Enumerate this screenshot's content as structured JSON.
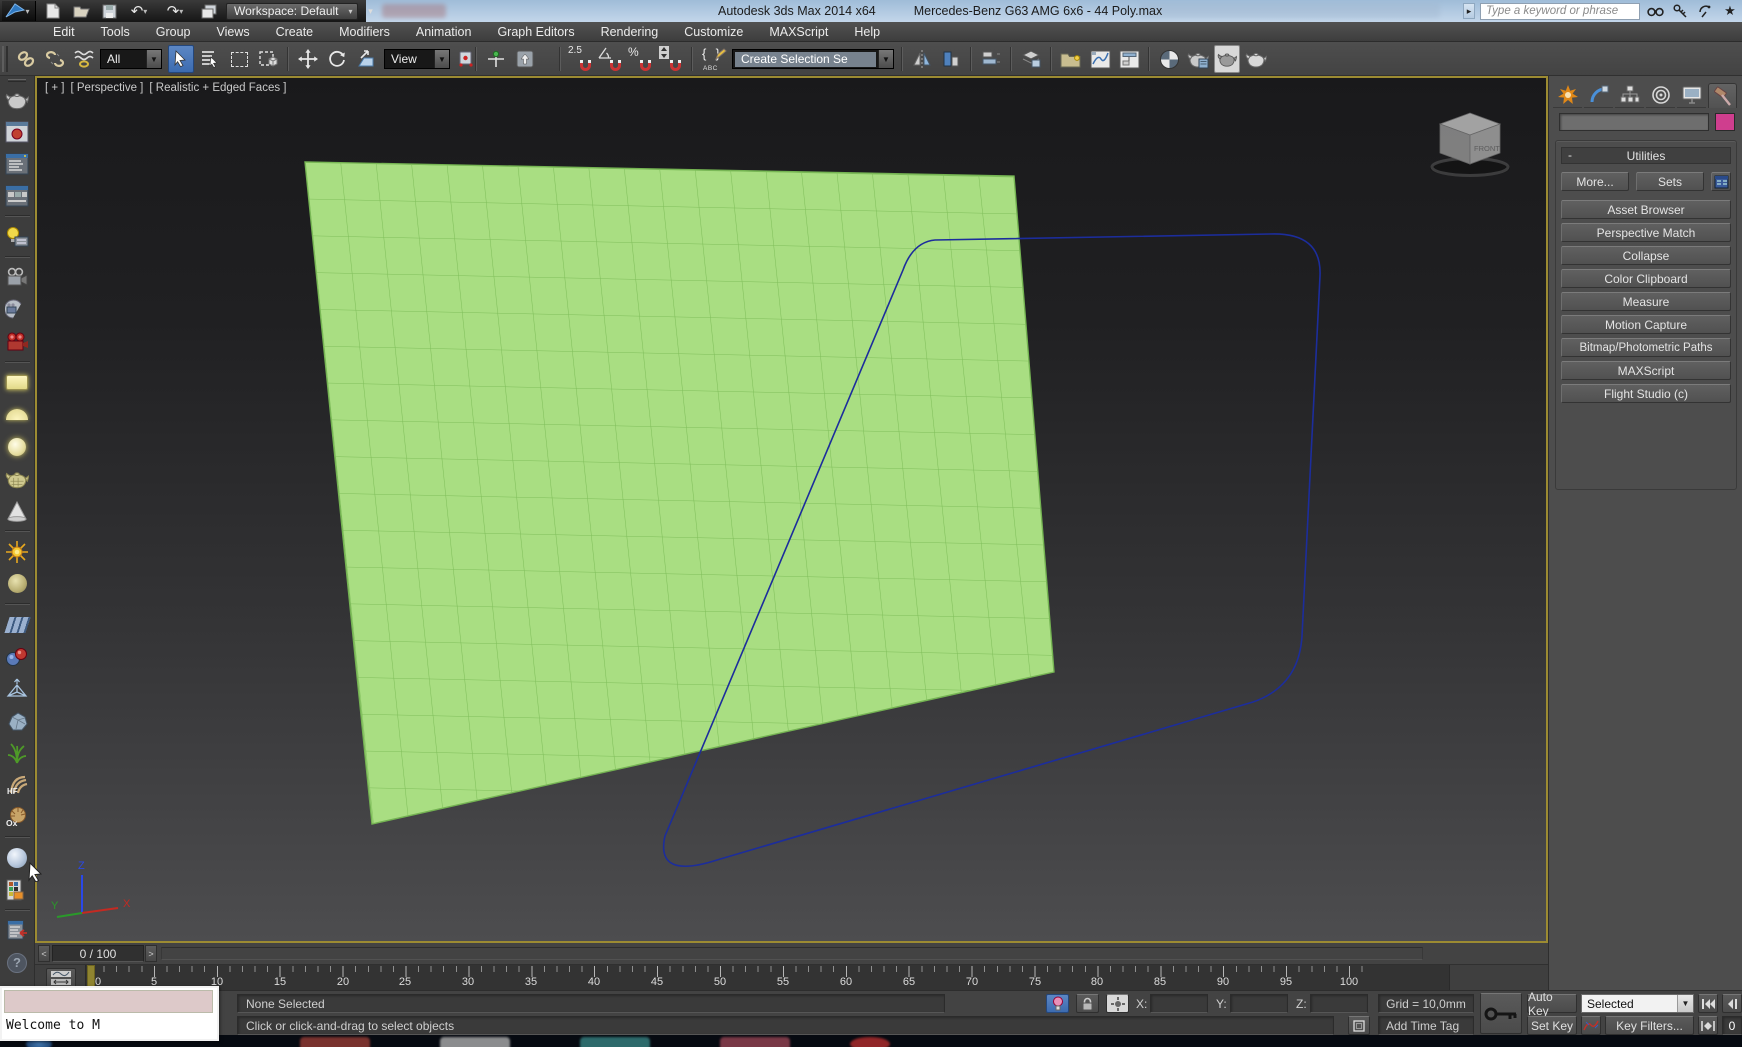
{
  "window": {
    "app_title": "Autodesk 3ds Max  2014 x64",
    "document_title": "Mercedes-Benz G63 AMG 6x6 - 44 Poly.max",
    "workspace_label": "Workspace: Default",
    "search_placeholder": "Type a keyword or phrase"
  },
  "menubar": {
    "items": [
      "Edit",
      "Tools",
      "Group",
      "Views",
      "Create",
      "Modifiers",
      "Animation",
      "Graph Editors",
      "Rendering",
      "Customize",
      "MAXScript",
      "Help"
    ]
  },
  "toolbar": {
    "selection_filter_value": "All",
    "reference_coordsys_value": "View",
    "named_sets_value": "Create Selection Se",
    "snap_25_label": "2.5",
    "snap_percent_label": "%",
    "abc_label": "ABC",
    "icons": [
      "select-and-link",
      "unlink-selection",
      "bind-to-space-warp",
      "selection-filter",
      "select-object",
      "select-by-name",
      "rectangular-selection-region",
      "window-crossing",
      "select-and-move",
      "select-and-rotate",
      "select-and-scale",
      "reference-coordinate-system",
      "use-pivot-point-center",
      "select-and-manipulate",
      "keyboard-shortcut-override",
      "snaps-toggle-2.5",
      "angle-snap",
      "percent-snap",
      "spinner-snap",
      "edit-named-selection-sets",
      "named-selection-sets",
      "mirror",
      "align",
      "layer-manager",
      "graphite-modeling-tools",
      "scene-explorer",
      "curve-editor",
      "schematic-view",
      "material-editor",
      "render-setup",
      "rendered-frame-window",
      "render-production"
    ]
  },
  "viewport": {
    "label_plus": "[ + ]",
    "label_view": "[ Perspective ]",
    "label_shading": "[ Realistic + Edged Faces ]",
    "viewcube_front_label": "FRONT",
    "axis": {
      "x": "X",
      "y": "Y",
      "z": "Z"
    },
    "border_color": "#9c8b32",
    "plane_fill": "#a9de82",
    "plane_grid_color": "#7fbe5a",
    "spline_color": "#1c2d9c"
  },
  "command_panel": {
    "tabs": [
      "create",
      "modify",
      "hierarchy",
      "motion",
      "display",
      "utilities"
    ],
    "active_tab": "utilities",
    "swatch_color": "#cf3e8e",
    "utilities": {
      "header": "Utilities",
      "collapse_glyph": "-",
      "more_label": "More...",
      "sets_label": "Sets",
      "buttons": [
        "Asset Browser",
        "Perspective Match",
        "Collapse",
        "Color Clipboard",
        "Measure",
        "Motion Capture",
        "Bitmap/Photometric Paths",
        "MAXScript",
        "Flight Studio (c)"
      ]
    }
  },
  "left_toolbar": {
    "icons": [
      "teapot-render",
      "rendered-frame-buffer",
      "render-dialog",
      "video-post-dialog",
      "light-lister",
      "camera-grey",
      "camera-dome",
      "camera-red",
      "plane-primitive",
      "dome-primitive",
      "sphere-primitive",
      "wire-teapot",
      "cone-primitive",
      "sun-daylight",
      "olive-sphere",
      "cube-array",
      "metaball-spheres",
      "ffd-lattice",
      "rock-object",
      "grass-foliage",
      "hair-fur-hf",
      "fur-ox",
      "blue-sphere",
      "texture-palette",
      "script-dialog",
      "help"
    ]
  },
  "timeline": {
    "prev_glyph": "<",
    "next_glyph": ">",
    "slider_value": "0 / 100",
    "ruler_labels": [
      "0",
      "5",
      "10",
      "15",
      "20",
      "25",
      "30",
      "35",
      "40",
      "45",
      "50",
      "55",
      "60",
      "65",
      "70",
      "75",
      "80",
      "85",
      "90",
      "95",
      "100"
    ]
  },
  "status_bar": {
    "selection_status": "None Selected",
    "prompt": "Click or click-and-drag to select objects",
    "x_label": "X:",
    "y_label": "Y:",
    "z_label": "Z:",
    "grid_label": "Grid = 10,0mm",
    "add_time_tag": "Add Time Tag",
    "auto_key": "Auto Key",
    "set_key": "Set Key",
    "selected_mode": "Selected",
    "key_filters": "Key Filters...",
    "frame_field": "0"
  },
  "overlay_window": {
    "title": "Welcome to M"
  }
}
